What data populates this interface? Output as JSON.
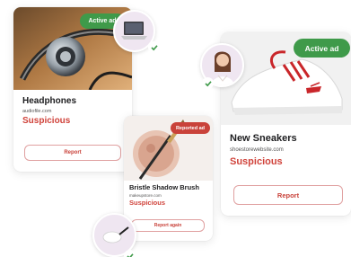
{
  "colors": {
    "active": "#3f9a4a",
    "reported": "#c9423a",
    "suspicious": "#d0433b",
    "avatar_bg": "#efe6f1"
  },
  "cards": [
    {
      "badge": "Active ad",
      "title": "Headphones",
      "site": "audiofile.com",
      "status": "Suspicious",
      "button": "Report"
    },
    {
      "badge": "Reported ad",
      "title": "Bristle Shadow Brush",
      "site": "makeupstore.com",
      "status": "Suspicious",
      "button": "Report again"
    },
    {
      "badge": "Active ad",
      "title": "New Sneakers",
      "site": "shoestorewebsite.com",
      "status": "Suspicious",
      "button": "Report"
    }
  ],
  "icons": {
    "check": "checkmark-icon",
    "laptop": "laptop-icon",
    "person": "person-avatar",
    "mouse": "mouse-icon"
  }
}
